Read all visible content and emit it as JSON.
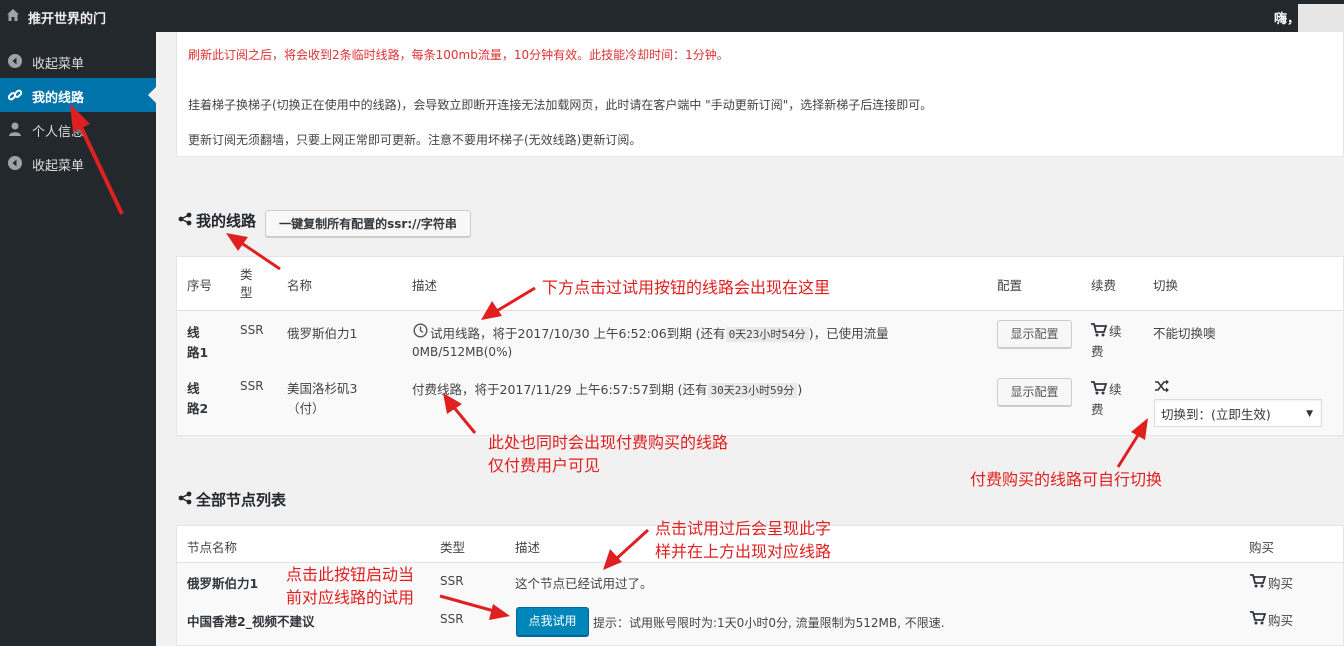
{
  "topbar": {
    "site_title": "推开世界的门",
    "greeting": "嗨，"
  },
  "sidebar": {
    "items": [
      {
        "label": "收起菜单",
        "icon": "collapse-icon",
        "active": false
      },
      {
        "label": "我的线路",
        "icon": "link-icon",
        "active": true
      },
      {
        "label": "个人信息",
        "icon": "user-icon",
        "active": false
      },
      {
        "label": "收起菜单",
        "icon": "collapse-icon",
        "active": false
      }
    ]
  },
  "notice": {
    "line1": "刷新此订阅之后，将会收到2条临时线路，每条100mb流量，10分钟有效。此技能冷却时间：1分钟。",
    "line2": "挂着梯子换梯子(切换正在使用中的线路)，会导致立即断开连接无法加载网页，此时请在客户端中 \"手动更新订阅\"，选择新梯子后连接即可。",
    "line3": "更新订阅无须翻墙，只要上网正常即可更新。注意不要用坏梯子(无效线路)更新订阅。"
  },
  "my_lines": {
    "title": "我的线路",
    "copy_button": "一键复制所有配置的ssr://字符串",
    "columns": {
      "index": "序号",
      "type": "类型",
      "name": "名称",
      "desc": "描述",
      "config": "配置",
      "renew": "续费",
      "switch": "切换"
    },
    "rows": [
      {
        "index": "线路1",
        "type": "SSR",
        "name": "俄罗斯伯力1",
        "desc_a": "试用线路，将于2017/10/30 上午6:52:06到期 (还有",
        "remaining": "0天23小时54分",
        "desc_b": ")，已使用流量",
        "desc_c": "0MB/512MB(0%)",
        "config_button": "显示配置",
        "renew": "续费",
        "switch_text": "不能切换噢"
      },
      {
        "index": "线路2",
        "type": "SSR",
        "name": "美国洛杉矶3（付）",
        "desc_a": "付费线路，将于2017/11/29 上午6:57:57到期 (还有",
        "remaining": "30天23小时59分",
        "desc_b": ")",
        "config_button": "显示配置",
        "renew": "续费",
        "switch_select": "切换到：(立即生效)"
      }
    ]
  },
  "all_nodes": {
    "title": "全部节点列表",
    "columns": {
      "name": "节点名称",
      "type": "类型",
      "desc": "描述",
      "buy": "购买"
    },
    "rows": [
      {
        "name": "俄罗斯伯力1",
        "type": "SSR",
        "desc": "这个节点已经试用过了。",
        "buy": "购买"
      },
      {
        "name": "中国香港2_视频不建议",
        "type": "SSR",
        "trial_button": "点我试用",
        "hint": "提示：试用账号限时为:1天0小时0分, 流量限制为512MB, 不限速.",
        "buy": "购买"
      }
    ]
  },
  "annotations": {
    "a1": "下方点击过试用按钮的线路会出现在这里",
    "a2_line1": "此处也同时会出现付费购买的线路",
    "a2_line2": "仅付费用户可见",
    "a3": "付费购买的线路可自行切换",
    "a4_line1": "点击试用过后会呈现此字",
    "a4_line2": "样并在上方出现对应线路",
    "a5_line1": "点击此按钮启动当",
    "a5_line2": "前对应线路的试用"
  },
  "colors": {
    "sidebar_bg": "#23282d",
    "active_bg": "#0073aa",
    "notice_red": "#dc3232",
    "primary_button": "#0085ba",
    "annotation_red": "#e02020"
  }
}
